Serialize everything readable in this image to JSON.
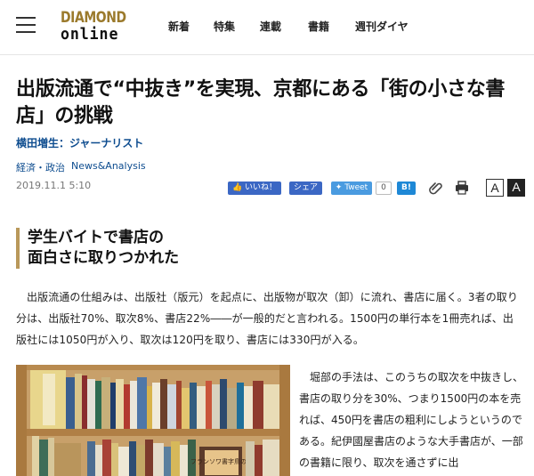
{
  "header": {
    "logo_line1": "DIAMOND",
    "logo_line2": "online",
    "nav": [
      "新着",
      "特集",
      "連載",
      "書籍",
      "週刊ダイヤ"
    ]
  },
  "article": {
    "title": "出版流通で“中抜き”を実現、京都にある「街の小さな書店」の挑戦",
    "author": "横田増生：ジャーナリスト",
    "categories": [
      "経済・政治",
      "News&Analysis"
    ],
    "date": "2019.11.1 5:10",
    "heading_line1": "学生バイトで書店の",
    "heading_line2": "面白さに取りつかれた",
    "paragraph1": "出版流通の仕組みは、出版社（版元）を起点に、出版物が取次（卸）に流れ、書店に届く。3者の取り分は、出版社70%、取次8%、書店22%――が一般的だと言われる。1500円の単行本を1冊売れば、出版社には1050円が入り、取次は120円を取り、書店には330円が入る。",
    "paragraph2": "堀部の手法は、このうちの取次を中抜きし、書店の取り分を30%、つまり1500円の本を売れば、450円を書店の粗利にしようというのである。紀伊國屋書店のような大手書店が、一部の書籍に限り、取次を通さずに出"
  },
  "share": {
    "like": "いいね！",
    "share": "シェア",
    "tweet": "Tweet",
    "tweet_count": "0",
    "hatena": "B!",
    "font_small": "A",
    "font_large": "A"
  },
  "photo": {
    "book_label": "フランソワ書字鳥の絵"
  },
  "colors": {
    "accent_gold": "#b9985a",
    "link_blue": "#0d4c8f",
    "facebook": "#3b67c4",
    "twitter": "#4a9be0",
    "hatena": "#1e88d6"
  }
}
